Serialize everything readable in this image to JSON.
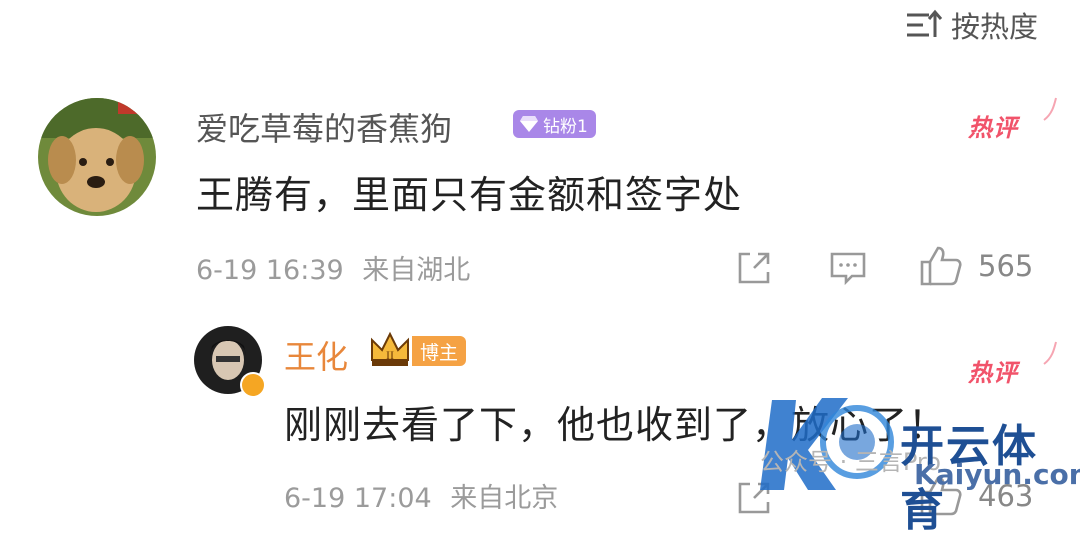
{
  "sort": {
    "label": "按热度"
  },
  "comment1": {
    "username": "爱吃草莓的香蕉狗",
    "fan_badge": "钻粉1",
    "hot_label": "热评",
    "text": "王腾有，里面只有金额和签字处",
    "time": "6-19 16:39",
    "location": "来自湖北",
    "likes": "565"
  },
  "comment2": {
    "username": "王化",
    "role_badge": "博主",
    "hot_label": "热评",
    "text": "刚刚去看了下，他也收到了，放心了！",
    "time": "6-19 17:04",
    "location": "来自北京",
    "likes": "463"
  },
  "watermark": {
    "brand": "开云体育",
    "url": "Kaiyun.com",
    "wechat": "公众号 · 三言Pro"
  },
  "colors": {
    "hot": "#f1536a",
    "blogger_name": "#e8873b",
    "fan_badge": "#a987e8",
    "blogger_badge": "#f5a244"
  }
}
